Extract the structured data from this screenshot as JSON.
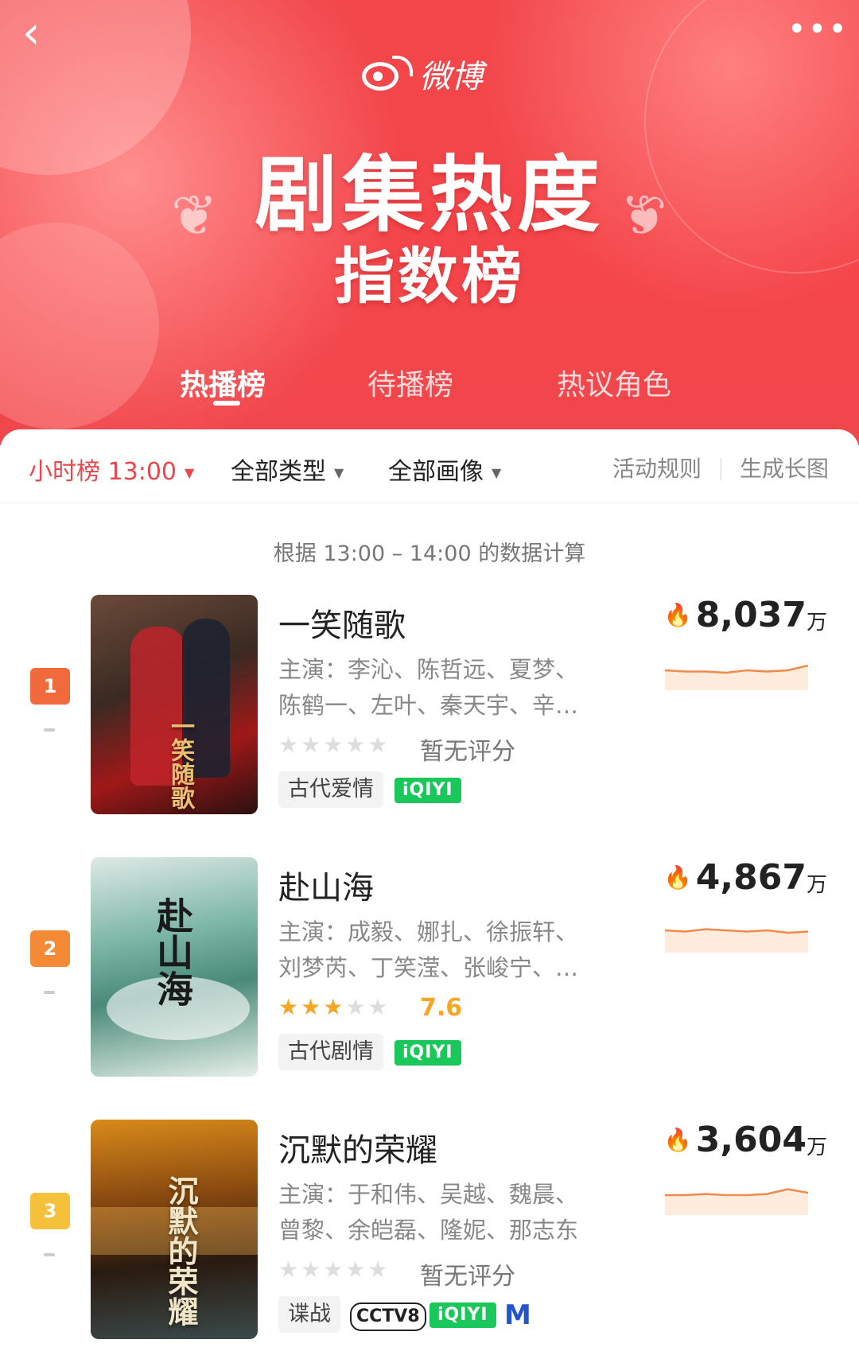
{
  "brand": {
    "name": "微博"
  },
  "header": {
    "title": "剧集热度",
    "subtitle": "指数榜",
    "back_icon": "‹",
    "more_icon": "•••"
  },
  "tabs": [
    {
      "label": "热播榜",
      "active": true
    },
    {
      "label": "待播榜",
      "active": false
    },
    {
      "label": "热议角色",
      "active": false
    }
  ],
  "filters": {
    "hour": "小时榜 13:00",
    "type": "全部类型",
    "picture": "全部画像",
    "rules": "活动规则",
    "generate": "生成长图"
  },
  "note": "根据 13:00 – 14:00 的数据计算",
  "items": [
    {
      "rank": "1",
      "rank_color": "#f06a3b",
      "name": "一笑随歌",
      "cast": "主演：李沁、陈哲远、夏梦、陈鹤一、左叶、秦天宇、辛…",
      "rating": 0,
      "score_text": "暂无评分",
      "tag": "古代爱情",
      "platforms": [
        "iQIYI"
      ],
      "heat": "8,037",
      "unit": "万",
      "poster_title": "一笑随歌",
      "trend": [
        0.5,
        0.55,
        0.55,
        0.6,
        0.5,
        0.55,
        0.5,
        0.3
      ]
    },
    {
      "rank": "2",
      "rank_color": "#f48a35",
      "name": "赴山海",
      "cast": "主演：成毅、娜扎、徐振轩、刘梦芮、丁笑滢、张峻宁、…",
      "rating": 3,
      "score_text": "7.6",
      "tag": "古代剧情",
      "platforms": [
        "iQIYI"
      ],
      "heat": "4,867",
      "unit": "万",
      "poster_title": "赴山海",
      "trend": [
        0.4,
        0.45,
        0.35,
        0.4,
        0.45,
        0.4,
        0.5,
        0.45
      ]
    },
    {
      "rank": "3",
      "rank_color": "#f5c03a",
      "name": "沉默的荣耀",
      "cast": "主演：于和伟、吴越、魏晨、曾黎、余皑磊、隆妮、那志东",
      "rating": 0,
      "score_text": "暂无评分",
      "tag": "谍战",
      "platforms": [
        "CCTV8",
        "iQIYI",
        "M"
      ],
      "heat": "3,604",
      "unit": "万",
      "poster_title": "沉默的荣耀",
      "trend": [
        0.5,
        0.5,
        0.45,
        0.5,
        0.5,
        0.45,
        0.25,
        0.4
      ]
    }
  ]
}
